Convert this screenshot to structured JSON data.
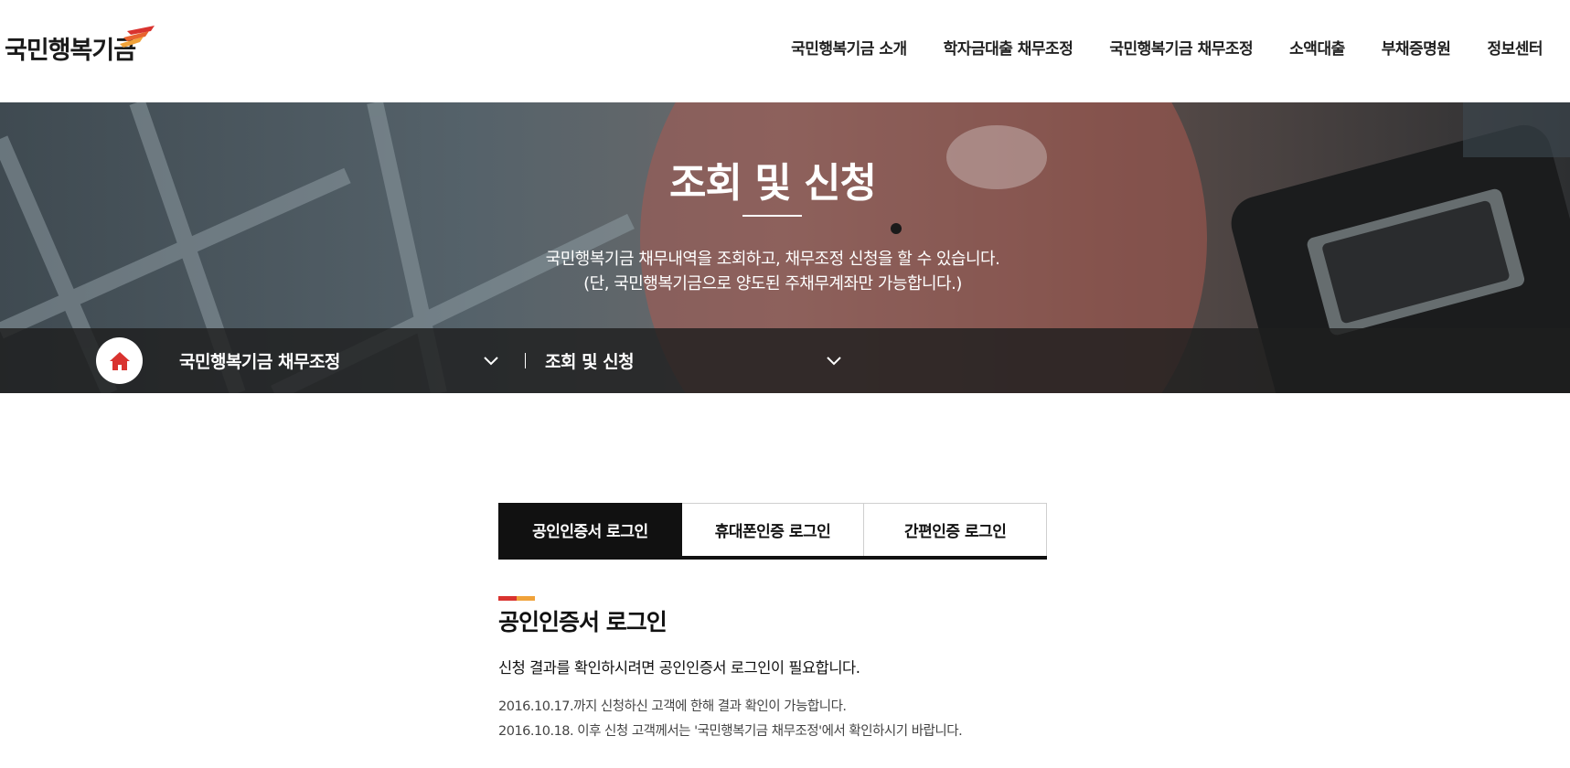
{
  "header": {
    "logo_text": "국민행복기금",
    "nav": [
      "국민행복기금 소개",
      "학자금대출 채무조정",
      "국민행복기금 채무조정",
      "소액대출",
      "부채증명원",
      "정보센터"
    ]
  },
  "hero": {
    "title": "조회 및 신청",
    "desc_line1": "국민행복기금 채무내역을 조회하고, 채무조정 신청을 할 수 있습니다.",
    "desc_line2": "(단, 국민행복기금으로 양도된 주채무계좌만 가능합니다.)"
  },
  "breadcrumb": {
    "home_icon": "home-icon",
    "level1": "국민행복기금 채무조정",
    "level2": "조회 및 신청"
  },
  "tabs": [
    {
      "label": "공인인증서 로그인",
      "active": true
    },
    {
      "label": "휴대폰인증 로그인",
      "active": false
    },
    {
      "label": "간편인증 로그인",
      "active": false
    }
  ],
  "content": {
    "title": "공인인증서 로그인",
    "lead": "신청 결과를 확인하시려면 공인인증서 로그인이 필요합니다.",
    "note1": "2016.10.17.까지 신청하신 고객에 한해 결과 확인이 가능합니다.",
    "note2": "2016.10.18. 이후 신청 고객께서는 '국민행복기금 채무조정'에서 확인하시기 바랍니다."
  },
  "colors": {
    "accent_red": "#d9332f",
    "accent_orange": "#f0a23a",
    "home_icon": "#d9332f",
    "active_tab": "#111111"
  }
}
